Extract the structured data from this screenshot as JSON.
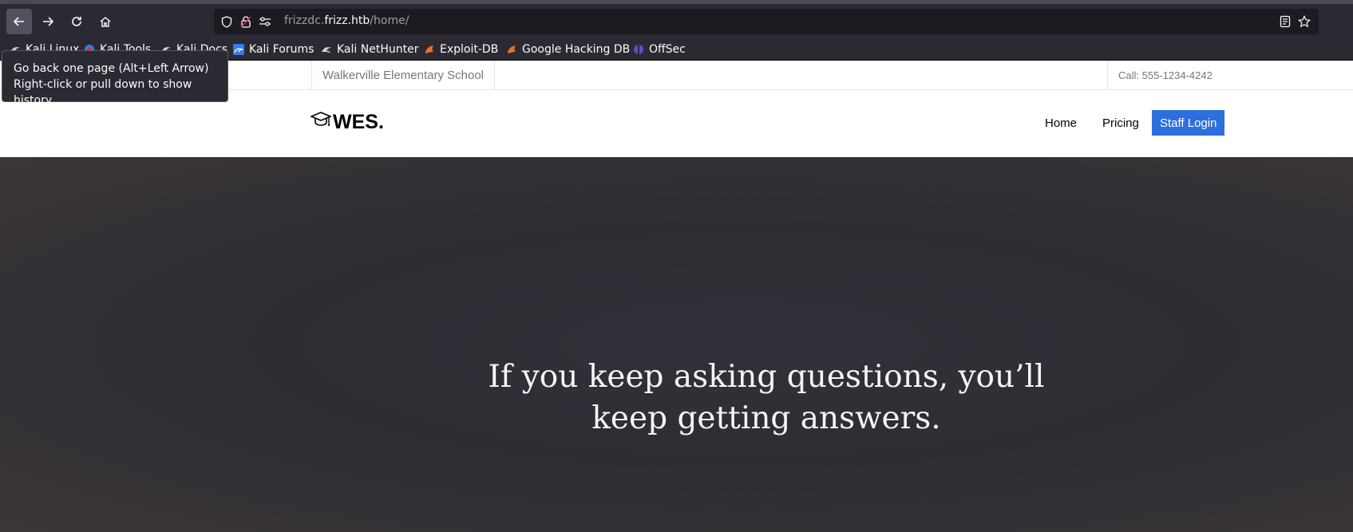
{
  "browser": {
    "url_prefix": "frizzdc.",
    "url_host": "frizz.htb",
    "url_path": "/home/",
    "tooltip_line1": "Go back one page (Alt+Left Arrow)",
    "tooltip_line2": "Right-click or pull down to show history",
    "bookmarks": [
      {
        "label": "Kali Linux",
        "icon": "kali-dragon-icon"
      },
      {
        "label": "Kali Tools",
        "icon": "kali-tools-icon"
      },
      {
        "label": "Kali Docs",
        "icon": "kali-dragon-icon"
      },
      {
        "label": "Kali Forums",
        "icon": "kali-forums-icon"
      },
      {
        "label": "Kali NetHunter",
        "icon": "kali-dragon-icon"
      },
      {
        "label": "Exploit-DB",
        "icon": "exploit-db-icon"
      },
      {
        "label": "Google Hacking DB",
        "icon": "exploit-db-icon"
      },
      {
        "label": "OffSec",
        "icon": "offsec-icon"
      }
    ]
  },
  "site": {
    "school_name": "Walkerville Elementary School",
    "phone": "Call: 555-1234-4242",
    "logo_text": "WES.",
    "nav": {
      "home": "Home",
      "pricing": "Pricing",
      "staff_login": "Staff Login"
    },
    "hero_line1": "If you keep asking questions, you’ll",
    "hero_line2": "keep getting answers."
  },
  "colors": {
    "accent": "#2d6fde",
    "chrome": "#2b2a33"
  }
}
